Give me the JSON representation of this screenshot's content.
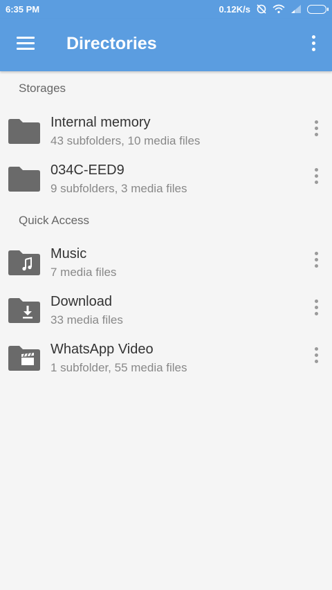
{
  "status_bar": {
    "time": "6:35 PM",
    "speed": "0.12K/s",
    "icons": [
      "sync-off-icon",
      "wifi-icon",
      "signal-icon",
      "battery-icon"
    ]
  },
  "app_bar": {
    "title": "Directories",
    "color": "#5b9de0"
  },
  "sections": {
    "storages": {
      "header": "Storages",
      "items": [
        {
          "name": "Internal memory",
          "sub": "43 subfolders, 10 media files",
          "icon": "folder-icon"
        },
        {
          "name": "034C-EED9",
          "sub": "9 subfolders, 3 media files",
          "icon": "folder-icon"
        }
      ]
    },
    "quick_access": {
      "header": "Quick Access",
      "items": [
        {
          "name": "Music",
          "sub": "7 media files",
          "icon": "music-folder-icon"
        },
        {
          "name": "Download",
          "sub": "33 media files",
          "icon": "download-folder-icon"
        },
        {
          "name": "WhatsApp Video",
          "sub": "1 subfolder, 55 media files",
          "icon": "video-folder-icon"
        }
      ]
    }
  }
}
